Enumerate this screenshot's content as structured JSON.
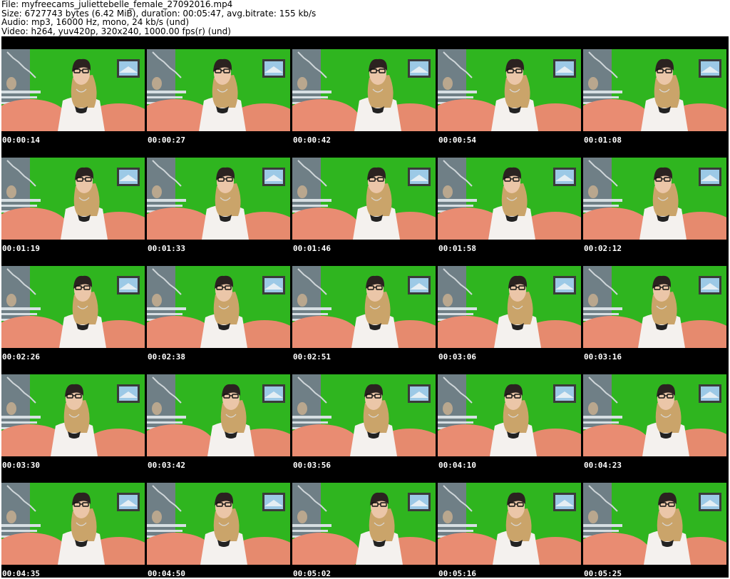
{
  "header": {
    "file_line": "File: myfreecams_juliettebelle_female_27092016.mp4",
    "size_line": "Size: 6727743 bytes (6.42 MiB), duration: 00:05:47, avg.bitrate: 155 kb/s",
    "audio_line": "Audio: mp3, 16000 Hz, mono, 24 kb/s (und)",
    "video_line": "Video: h264, yuv420p, 320x240, 1000.00 fps(r) (und)"
  },
  "colors": {
    "background": "#000000",
    "green_screen": "#2fb51f",
    "timestamp_text": "#ffffff"
  },
  "frames": [
    {
      "timestamp": "00:00:14"
    },
    {
      "timestamp": "00:00:27"
    },
    {
      "timestamp": "00:00:42"
    },
    {
      "timestamp": "00:00:54"
    },
    {
      "timestamp": "00:01:08"
    },
    {
      "timestamp": "00:01:19"
    },
    {
      "timestamp": "00:01:33"
    },
    {
      "timestamp": "00:01:46"
    },
    {
      "timestamp": "00:01:58"
    },
    {
      "timestamp": "00:02:12"
    },
    {
      "timestamp": "00:02:26"
    },
    {
      "timestamp": "00:02:38"
    },
    {
      "timestamp": "00:02:51"
    },
    {
      "timestamp": "00:03:06"
    },
    {
      "timestamp": "00:03:16"
    },
    {
      "timestamp": "00:03:30"
    },
    {
      "timestamp": "00:03:42"
    },
    {
      "timestamp": "00:03:56"
    },
    {
      "timestamp": "00:04:10"
    },
    {
      "timestamp": "00:04:23"
    },
    {
      "timestamp": "00:04:35"
    },
    {
      "timestamp": "00:04:50"
    },
    {
      "timestamp": "00:05:02"
    },
    {
      "timestamp": "00:05:16"
    },
    {
      "timestamp": "00:05:25"
    }
  ]
}
